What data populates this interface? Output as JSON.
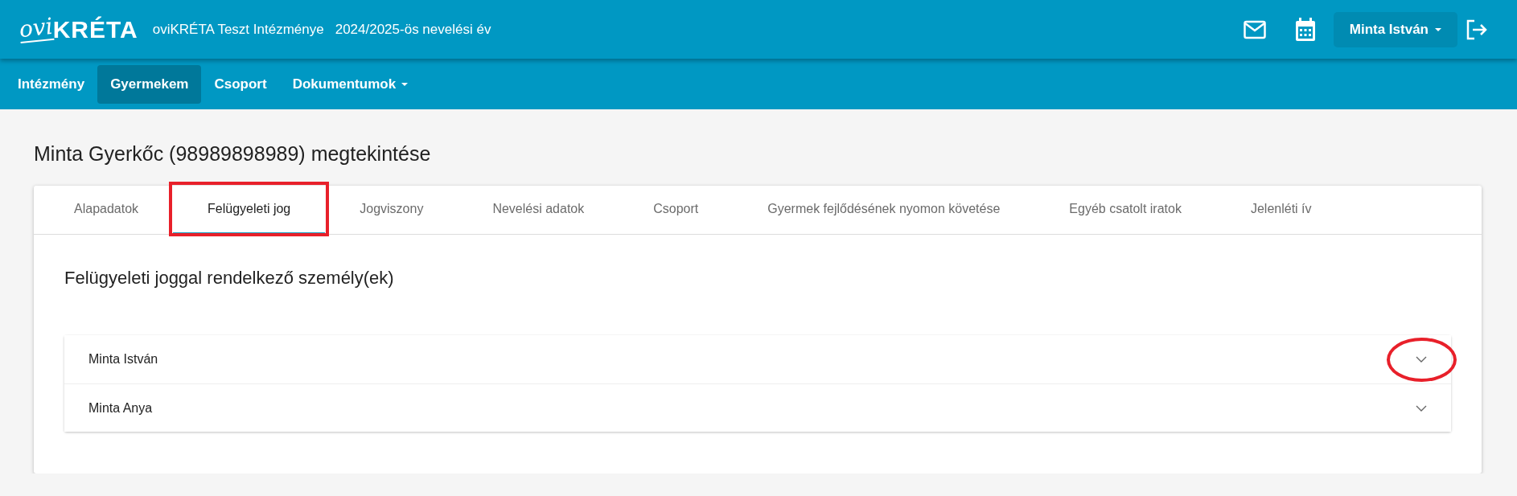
{
  "logo": {
    "prefix": "ovi",
    "name": "KRÉTA"
  },
  "header": {
    "institution": "oviKRÉTA Teszt Intézménye",
    "school_year": "2024/2025-ös nevelési év",
    "user_menu": "Minta István"
  },
  "nav": [
    {
      "label": "Intézmény",
      "selected": false,
      "dropdown": false
    },
    {
      "label": "Gyermekem",
      "selected": true,
      "dropdown": false
    },
    {
      "label": "Csoport",
      "selected": false,
      "dropdown": false
    },
    {
      "label": "Dokumentumok",
      "selected": false,
      "dropdown": true
    }
  ],
  "page_title": "Minta Gyerkőc (98989898989) megtekintése",
  "tabs": [
    {
      "label": "Alapadatok",
      "selected": false,
      "highlighted": false
    },
    {
      "label": "Felügyeleti jog",
      "selected": true,
      "highlighted": true
    },
    {
      "label": "Jogviszony",
      "selected": false,
      "highlighted": false
    },
    {
      "label": "Nevelési adatok",
      "selected": false,
      "highlighted": false
    },
    {
      "label": "Csoport",
      "selected": false,
      "highlighted": false
    },
    {
      "label": "Gyermek fejlődésének nyomon követése",
      "selected": false,
      "highlighted": false
    },
    {
      "label": "Egyéb csatolt iratok",
      "selected": false,
      "highlighted": false
    },
    {
      "label": "Jelenléti ív",
      "selected": false,
      "highlighted": false
    }
  ],
  "section_title": "Felügyeleti joggal rendelkező személy(ek)",
  "persons": [
    {
      "name": "Minta István",
      "expanded": false,
      "circled": true
    },
    {
      "name": "Minta Anya",
      "expanded": false,
      "circled": false
    }
  ]
}
